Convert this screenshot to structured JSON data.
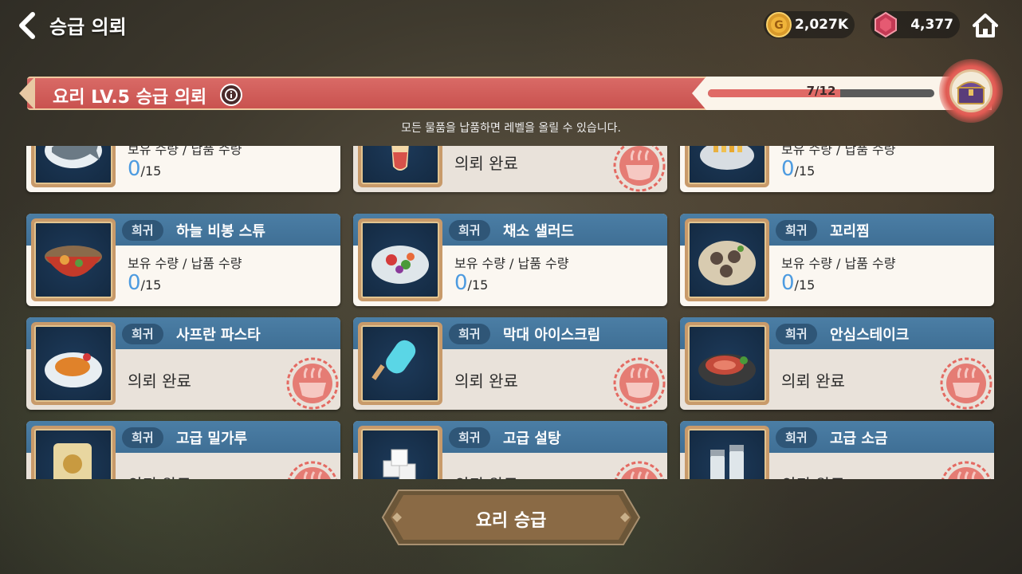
{
  "header": {
    "title": "승급 의뢰",
    "gold": "2,027K",
    "gems": "4,377"
  },
  "banner": {
    "title": "요리 LV.5 승급 의뢰",
    "progress_text": "7/12",
    "progress_fraction": 0.583,
    "subtitle": "모든 물품을 납품하면 레벨을 올릴 수 있습니다."
  },
  "labels": {
    "qty": "보유 수량 / 납품 수량",
    "done": "의뢰 완료"
  },
  "cards": [
    {
      "rarity": "",
      "name": "",
      "status": "pending",
      "owned": "0",
      "need": "/15",
      "icon": "fish-dish-icon"
    },
    {
      "rarity": "",
      "name": "",
      "status": "done",
      "icon": "drink-icon"
    },
    {
      "rarity": "",
      "name": "",
      "status": "pending",
      "owned": "0",
      "need": "/15",
      "icon": "fries-plate-icon"
    },
    {
      "rarity": "희귀",
      "name": "하늘 비봉 스튜",
      "status": "pending",
      "owned": "0",
      "need": "/15",
      "icon": "stew-pot-icon"
    },
    {
      "rarity": "희귀",
      "name": "채소 샐러드",
      "status": "pending",
      "owned": "0",
      "need": "/15",
      "icon": "salad-icon"
    },
    {
      "rarity": "희귀",
      "name": "꼬리찜",
      "status": "pending",
      "owned": "0",
      "need": "/15",
      "icon": "braised-tail-icon"
    },
    {
      "rarity": "희귀",
      "name": "사프란 파스타",
      "status": "done",
      "icon": "pasta-icon"
    },
    {
      "rarity": "희귀",
      "name": "막대 아이스크림",
      "status": "done",
      "icon": "popsicle-icon"
    },
    {
      "rarity": "희귀",
      "name": "안심스테이크",
      "status": "done",
      "icon": "steak-icon"
    },
    {
      "rarity": "희귀",
      "name": "고급 밀가루",
      "status": "done",
      "icon": "flour-sack-icon"
    },
    {
      "rarity": "희귀",
      "name": "고급 설탕",
      "status": "done",
      "icon": "sugar-cubes-icon"
    },
    {
      "rarity": "희귀",
      "name": "고급 소금",
      "status": "done",
      "icon": "salt-shakers-icon"
    }
  ],
  "footer": {
    "upgrade_label": "요리 승급"
  },
  "colors": {
    "banner": "#cf5a56",
    "card_header": "#4677a0",
    "owned_number": "#4d9be0",
    "stamp": "#e46a62"
  }
}
